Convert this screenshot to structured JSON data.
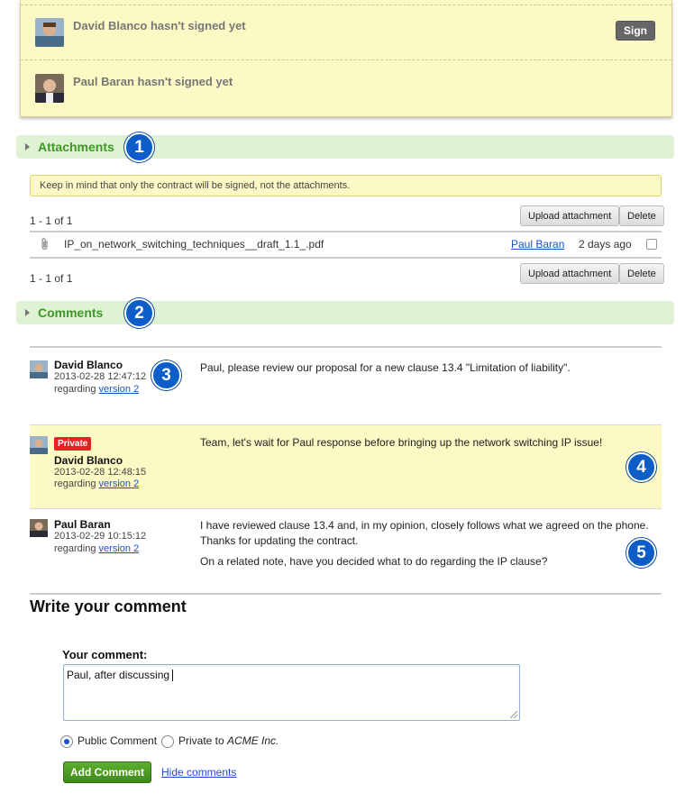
{
  "signers": [
    {
      "name": "David Blanco",
      "status": "David Blanco hasn't signed yet",
      "sign_button": "Sign"
    },
    {
      "name": "Paul Baran",
      "status": "Paul Baran hasn't signed yet"
    }
  ],
  "attachments": {
    "title": "Attachments",
    "badge": "1",
    "notice": "Keep in mind that only the contract will be signed, not the attachments.",
    "pager_top": "1 - 1 of 1",
    "pager_bottom": "1 - 1 of 1",
    "upload_label": "Upload attachment",
    "delete_label": "Delete",
    "files": [
      {
        "name": "IP_on_network_switching_techniques__draft_1.1_.pdf",
        "owner": "Paul Baran",
        "age": "2 days ago"
      }
    ]
  },
  "comments_section": {
    "title": "Comments",
    "badge": "2",
    "items": [
      {
        "author": "David Blanco",
        "date": "2013-02-28 12:47:12",
        "regarding_prefix": "regarding",
        "version": "version 2",
        "text": "Paul, please review our proposal for a new clause 13.4 \"Limitation of liability\".",
        "badge": "3"
      },
      {
        "private_label": "Private",
        "author": "David Blanco",
        "date": "2013-02-28 12:48:15",
        "regarding_prefix": "regarding",
        "version": "version 2",
        "text": "Team, let's wait for Paul response before bringing up the network switching IP issue!",
        "badge": "4"
      },
      {
        "author": "Paul Baran",
        "date": "2013-02-29 10:15:12",
        "regarding_prefix": "regarding",
        "version": "version 2",
        "text_lines": [
          "I have reviewed clause 13.4 and, in my opinion, closely follows what we agreed on the phone.",
          "Thanks for updating the contract.",
          "On a related note, have you decided what to do regarding the IP clause?"
        ],
        "badge": "5"
      }
    ]
  },
  "write": {
    "title": "Write your comment",
    "label": "Your comment:",
    "value": "Paul, after discussing",
    "public_label": "Public Comment",
    "private_prefix": "Private to",
    "private_org": "ACME Inc.",
    "add_button": "Add Comment",
    "hide_link": "Hide comments"
  }
}
